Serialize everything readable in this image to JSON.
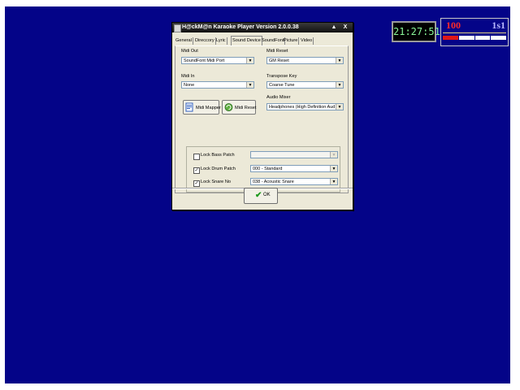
{
  "window": {
    "title": "H@ckM@n Karaoke Player Version 2.0.0.38",
    "minimize": "▲",
    "close": "X"
  },
  "tabs": [
    {
      "label": "General"
    },
    {
      "label": "Direccory"
    },
    {
      "label": "Lyric"
    },
    {
      "label": "Sound Device",
      "active": true
    },
    {
      "label": "SoundFont"
    },
    {
      "label": "Picture"
    },
    {
      "label": "Video"
    }
  ],
  "sound_device": {
    "midi_out": {
      "label": "Midi Out",
      "value": "SoundFont Midi Port"
    },
    "midi_reset": {
      "label": "Midi Reset",
      "value": "GM Reset"
    },
    "midi_in": {
      "label": "Midi In",
      "value": "None"
    },
    "transpose_key": {
      "label": "Transpose Key",
      "value": "Coarse Tune"
    },
    "audio_mixer": {
      "label": "Audio Mixer",
      "value": "Headphones (High Definition Aud"
    },
    "midi_mapper_button": "Midi Mapper",
    "midi_reset_button": "Midi Reset",
    "lock_bass": {
      "label": "Lock Bass Patch",
      "checked": false,
      "value": ""
    },
    "lock_drum": {
      "label": "Lock Drum Patch",
      "checked": true,
      "value": "000 - Standard"
    },
    "lock_snare": {
      "label": "Lock Snare No",
      "checked": true,
      "value": "038 - Acoustic Snare"
    }
  },
  "footer": {
    "ok_label": "OK",
    "ok_icon": "✔"
  },
  "clock": {
    "time": "21:27:51"
  },
  "score": {
    "left": "100",
    "right": "1s1",
    "level_segments_total": 4,
    "level_segments_active": 1,
    "colors": {
      "left": "#ff2a2a",
      "right": "#b8b8ff",
      "active": "#e01818"
    }
  },
  "colors": {
    "desktop": "#040488",
    "dialog": "#ece9d8"
  }
}
